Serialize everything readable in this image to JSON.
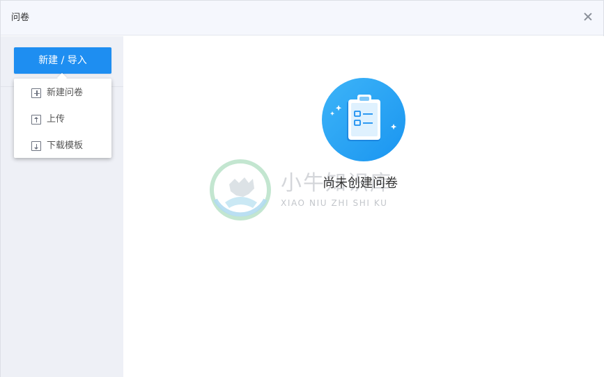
{
  "dialog": {
    "title": "问卷",
    "close_icon": "close-icon"
  },
  "sidebar": {
    "new_button_label": "新建 / 导入",
    "menu": [
      {
        "label": "新建问卷",
        "icon": "plus-square-icon"
      },
      {
        "label": "上传",
        "icon": "upload-icon"
      },
      {
        "label": "下载模板",
        "icon": "download-icon"
      }
    ]
  },
  "main": {
    "empty_icon": "clipboard-checklist-icon",
    "empty_text": "尚未创建问卷"
  },
  "watermark": {
    "cn": "小牛知识库",
    "en": "XIAO NIU ZHI SHI KU"
  },
  "colors": {
    "accent": "#1e8ef1",
    "empty_circle": "#29a6f6",
    "sidebar_bg": "#eef0f6",
    "titlebar_bg": "#f5f7fd"
  }
}
